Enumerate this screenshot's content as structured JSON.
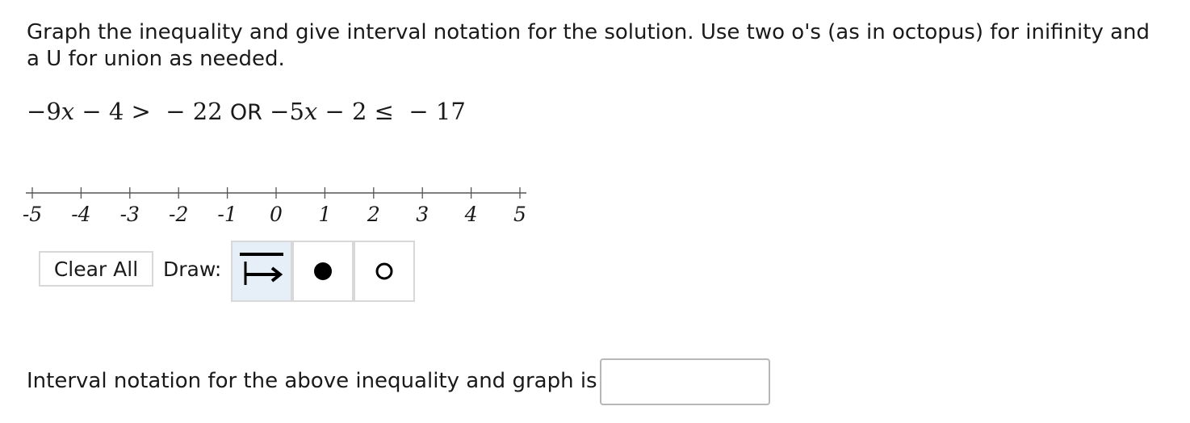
{
  "question": {
    "text": "Graph the inequality and give interval notation for the solution. Use two o's (as in octopus) for inifinity and a U for union as needed."
  },
  "inequality": {
    "part1_minus": "−",
    "part1_coef": "9",
    "part1_var": "x",
    "part1_rest": " − 4 >  − 22 ",
    "connector": "OR",
    "part2_minus": " −",
    "part2_coef": "5",
    "part2_var": "x",
    "part2_rest": " − 2 ≤  − 17"
  },
  "number_line": {
    "ticks": [
      "-5",
      "-4",
      "-3",
      "-2",
      "-1",
      "0",
      "1",
      "2",
      "3",
      "4",
      "5"
    ],
    "min": -5,
    "max": 5,
    "color": "#555555"
  },
  "toolbar": {
    "clear_label": "Clear All",
    "draw_label": "Draw:",
    "tools": [
      {
        "icon": "ray-arrow-icon",
        "selected": true
      },
      {
        "icon": "closed-dot-icon",
        "selected": false
      },
      {
        "icon": "open-dot-icon",
        "selected": false
      }
    ]
  },
  "answer": {
    "label": "Interval notation for the above inequality and graph is",
    "value": "",
    "placeholder": ""
  }
}
